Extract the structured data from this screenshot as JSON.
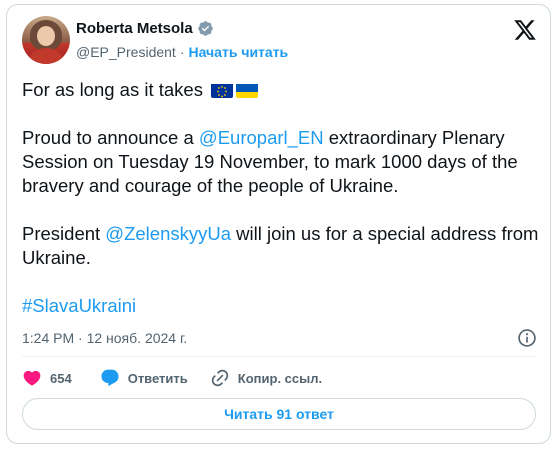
{
  "author": {
    "name": "Roberta Metsola",
    "handle": "@EP_President",
    "separator": "·",
    "follow_label": "Начать читать"
  },
  "tweet": {
    "line1": "For as long as it takes",
    "p2_prefix": "Proud to announce a ",
    "p2_mention": "@Europarl_EN",
    "p2_suffix": " extraordinary Plenary Session on Tuesday 19 November, to mark 1000 days of the bravery and courage of the people of Ukraine.",
    "p3_prefix": "President ",
    "p3_mention": "@ZelenskyyUa",
    "p3_suffix": " will join us for a special address from Ukraine.",
    "hashtag": "#SlavaUkraini"
  },
  "meta": {
    "timestamp": "1:24 PM · 12 нояб. 2024 г."
  },
  "actions": {
    "like_count": "654",
    "reply_label": "Ответить",
    "copy_link_label": "Копир. ссыл."
  },
  "replies_button": {
    "label": "Читать 91 ответ"
  },
  "colors": {
    "accent": "#1d9bf0",
    "like": "#f91880",
    "text": "#0f1419",
    "muted": "#536471",
    "border": "#cfd9de"
  }
}
